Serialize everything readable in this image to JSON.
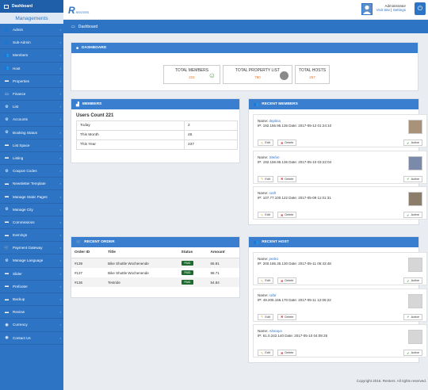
{
  "sidebar": {
    "header": "Dashboard",
    "subheader": "Managements",
    "items": [
      {
        "label": "Admin",
        "icon": "person-icon"
      },
      {
        "label": "Sub-Admin",
        "icon": "person-icon"
      },
      {
        "label": "Members",
        "icon": "group-icon"
      },
      {
        "label": "Host",
        "icon": "group-icon"
      },
      {
        "label": "Properties",
        "icon": "folder-icon"
      },
      {
        "label": "Finance",
        "icon": "money-icon"
      },
      {
        "label": "List",
        "icon": "gear-icon"
      },
      {
        "label": "Accounts",
        "icon": "gear-icon"
      },
      {
        "label": "Booking Status",
        "icon": "gear-icon"
      },
      {
        "label": "List Space",
        "icon": "folder-icon"
      },
      {
        "label": "Listing",
        "icon": "folder-icon"
      },
      {
        "label": "Coupon Codes",
        "icon": "gear-icon"
      },
      {
        "label": "Newsletter Template",
        "icon": "folder-icon"
      },
      {
        "label": "Manage Static Pages",
        "icon": "folder-icon"
      },
      {
        "label": "Manage City",
        "icon": "gear-icon"
      },
      {
        "label": "Commissions",
        "icon": "folder-icon"
      },
      {
        "label": "Earnings",
        "icon": "folder-icon"
      },
      {
        "label": "Payment Gateway",
        "icon": "cart-icon"
      },
      {
        "label": "Manage Language",
        "icon": "gear-icon"
      },
      {
        "label": "Slider",
        "icon": "folder-icon"
      },
      {
        "label": "Prefooter",
        "icon": "folder-icon"
      },
      {
        "label": "Backup",
        "icon": "folder-icon"
      },
      {
        "label": "Review",
        "icon": "folder-icon"
      },
      {
        "label": "Currency",
        "icon": "globe-icon"
      },
      {
        "label": "Contact Us",
        "icon": "globe-icon"
      }
    ]
  },
  "topbar": {
    "logo_mark": "R",
    "logo_text": "RENTERS",
    "user_name": "Administrator",
    "visit_site": "Visit Site",
    "separator": "|",
    "settings": "Settings"
  },
  "titlebar": {
    "label": "Dashboard"
  },
  "dashboard": {
    "title": "DASHBOARD",
    "stats": [
      {
        "label": "TOTAL MEMBERS",
        "value": "221"
      },
      {
        "label": "TOTAL PROPERTY LIST",
        "value": "780"
      },
      {
        "label": "TOTAL HOSTS",
        "value": "257"
      }
    ]
  },
  "members": {
    "title": "MEMBERS",
    "count_label": "Users Count 221",
    "rows": [
      {
        "label": "Today",
        "value": "2"
      },
      {
        "label": "This Month",
        "value": "48"
      },
      {
        "label": "This Year",
        "value": "237"
      }
    ]
  },
  "recent_members": {
    "title": "RECENT MEMBERS",
    "name_prefix": "Name:",
    "edit": "Edit",
    "delete": "Delete",
    "active": "Active",
    "items": [
      {
        "name": "deplina",
        "info": "IP: 192.156.95.136 Date: 2017-05-12 01:24:10"
      },
      {
        "name": "Stefan",
        "info": "IP: 192.156.95.136 Date: 2017-05-10 03:22:04"
      },
      {
        "name": "rash",
        "info": "IP: 107.77.100.122 Date: 2017-05-09 11:01:31"
      }
    ]
  },
  "recent_order": {
    "title": "RECENT ORDER",
    "headers": [
      "Order ID",
      "Title",
      "Status",
      "Amount"
    ],
    "rows": [
      {
        "id": "#139",
        "title": "Bike Shuttle Wochenende",
        "status": "PAID",
        "amount": "65.81"
      },
      {
        "id": "#137",
        "title": "Bike Shuttle Wochenende",
        "status": "PAID",
        "amount": "98.71"
      },
      {
        "id": "#136",
        "title": "Testride",
        "status": "PAID",
        "amount": "54.84"
      }
    ]
  },
  "recent_host": {
    "title": "RECENT HOST",
    "name_prefix": "Name:",
    "edit": "Edit",
    "delete": "Delete",
    "active": "Active",
    "items": [
      {
        "name": "pedro",
        "info": "IP: 200.186.35.130 Date: 2017-05-11 06:43:48"
      },
      {
        "name": "rafal",
        "info": "IP: 49.205.156.170 Date: 2017-05-11 12:06:22"
      },
      {
        "name": "Alonaya",
        "info": "IP: 61.0.242.140 Date: 2017-05-10 04:09:25"
      }
    ]
  },
  "footer": "Copyright 2016. Renters. All rights reserved.",
  "colors": {
    "primary": "#2d74c4",
    "accent": "#e3732d",
    "paid": "#1e6b2f"
  }
}
